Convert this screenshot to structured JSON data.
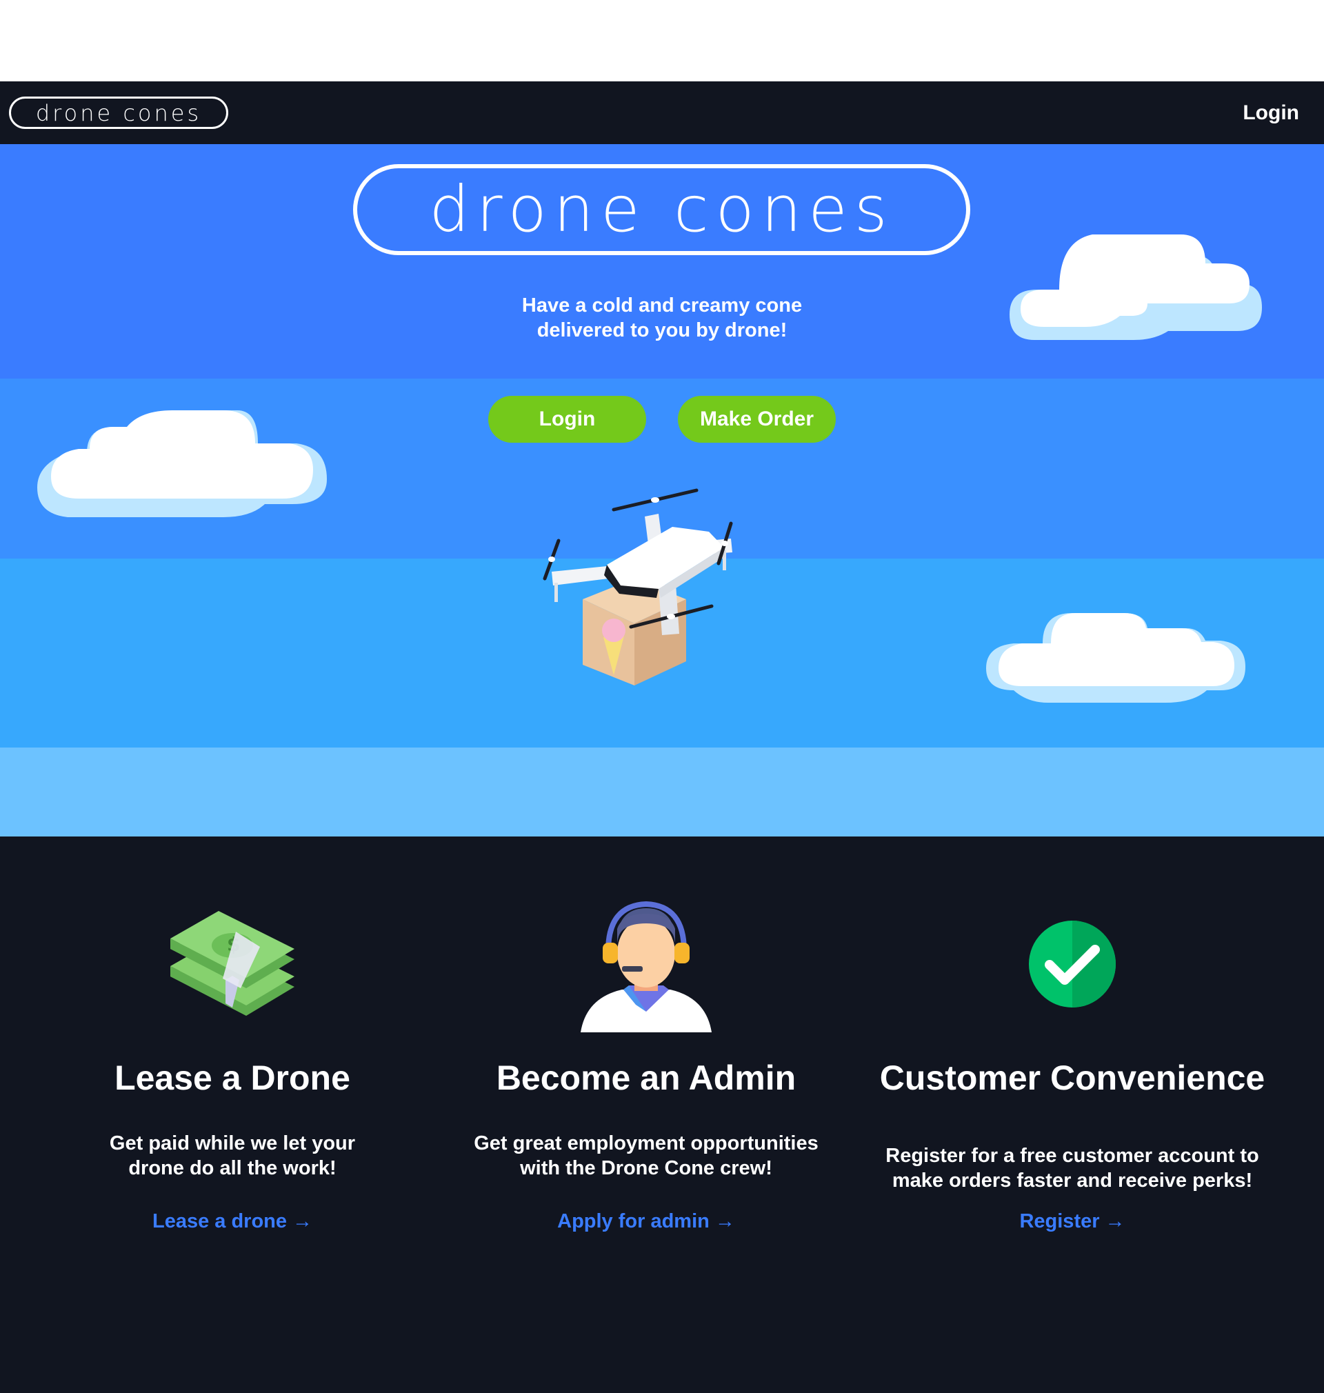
{
  "navbar": {
    "logo_text": "drone cones",
    "login_label": "Login"
  },
  "hero": {
    "logo_text": "drone cones",
    "tagline_line1": "Have a cold and creamy cone",
    "tagline_line2": "delivered to you by drone!",
    "login_button": "Login",
    "order_button": "Make Order"
  },
  "features": [
    {
      "title": "Lease a Drone",
      "desc_line1": "Get paid while we let your",
      "desc_line2": "drone do all the work!",
      "link": "Lease a drone",
      "icon": "money-stack-icon"
    },
    {
      "title": "Become an Admin",
      "desc_line1": "Get great employment opportunities",
      "desc_line2": "with the Drone Cone crew!",
      "link": "Apply for admin",
      "icon": "support-agent-icon"
    },
    {
      "title": "Customer Convenience",
      "desc_line1": "Register for a free customer account to",
      "desc_line2": "make orders faster and receive perks!",
      "link": "Register",
      "icon": "checkmark-icon"
    }
  ],
  "link_arrow": "→",
  "colors": {
    "navbar_bg": "#111520",
    "sky_top": "#3a7cff",
    "sky_mid": "#3a90ff",
    "sky_low": "#37a8fd",
    "sky_bottom": "#6cc2ff",
    "button_green": "#74c91b",
    "link_blue": "#3a7cff"
  }
}
